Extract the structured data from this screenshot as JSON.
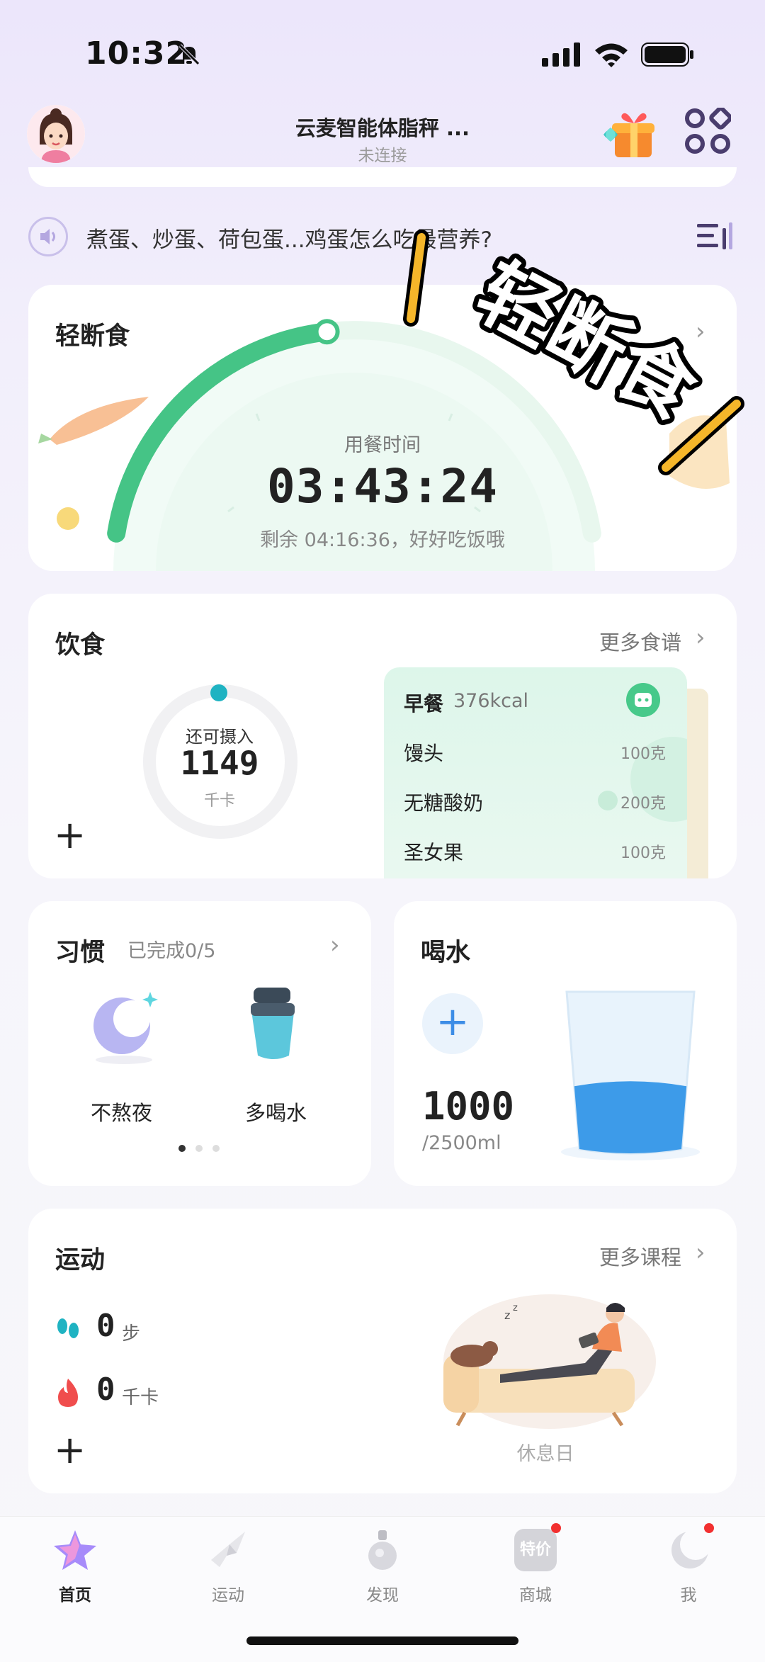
{
  "status_bar": {
    "time": "10:32"
  },
  "header": {
    "device_name": "云麦智能体脂秤 ...",
    "device_status": "未连接"
  },
  "news": {
    "text": "煮蛋、炒蛋、荷包蛋...鸡蛋怎么吃最营养?"
  },
  "fasting": {
    "title": "轻断食",
    "label": "用餐时间",
    "timer": "03:43:24",
    "remaining": "剩余 04:16:36，好好吃饭哦",
    "progress_fraction": 0.46,
    "sticker_text": "轻断食",
    "colors": {
      "arc": "#45c486",
      "track": "#eafaf2"
    }
  },
  "diet": {
    "title": "饮食",
    "more": "更多食谱",
    "ring_label": "还可摄入",
    "ring_value": "1149",
    "ring_unit": "千卡",
    "meal": {
      "name": "早餐",
      "kcal": "376kcal"
    },
    "foods": [
      {
        "name": "馒头",
        "qty": "100克"
      },
      {
        "name": "无糖酸奶",
        "qty": "200克"
      },
      {
        "name": "圣女果",
        "qty": "100克"
      }
    ],
    "colors": {
      "dot": "#1fb3c2"
    }
  },
  "habit": {
    "title": "习惯",
    "progress": "已完成0/5",
    "items": [
      {
        "name": "不熬夜",
        "icon": "moon-icon"
      },
      {
        "name": "多喝水",
        "icon": "water-bottle-icon"
      }
    ]
  },
  "water": {
    "title": "喝水",
    "amount": "1000",
    "goal": "/2500ml",
    "fill_fraction": 0.4,
    "colors": {
      "water": "#3d9be9"
    }
  },
  "sport": {
    "title": "运动",
    "more": "更多课程",
    "steps_value": "0",
    "steps_unit": "步",
    "kcal_value": "0",
    "kcal_unit": "千卡",
    "rest_label": "休息日"
  },
  "tabbar": {
    "tabs": [
      {
        "label": "首页",
        "active": true
      },
      {
        "label": "运动"
      },
      {
        "label": "发现"
      },
      {
        "label": "商城",
        "badge_text": "特价"
      },
      {
        "label": "我"
      }
    ]
  }
}
